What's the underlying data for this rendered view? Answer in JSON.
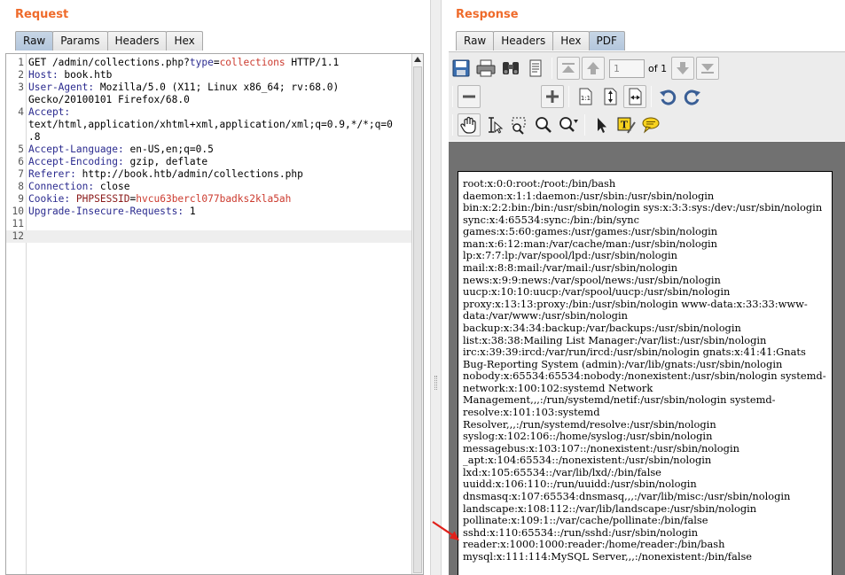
{
  "request": {
    "title": "Request",
    "tabs": [
      "Raw",
      "Params",
      "Headers",
      "Hex"
    ],
    "active_tab": "Raw",
    "lines": [
      {
        "num": "1",
        "segments": [
          {
            "t": "GET /admin/collections.php?",
            "c": "hval"
          },
          {
            "t": "type",
            "c": "pname"
          },
          {
            "t": "=",
            "c": "hval"
          },
          {
            "t": "collections",
            "c": "pval"
          },
          {
            "t": " HTTP/1.1",
            "c": "hval"
          }
        ]
      },
      {
        "num": "2",
        "segments": [
          {
            "t": "Host:",
            "c": "hname"
          },
          {
            "t": " book.htb",
            "c": "hval"
          }
        ]
      },
      {
        "num": "3",
        "segments": [
          {
            "t": "User-Agent:",
            "c": "hname"
          },
          {
            "t": " Mozilla/5.0 (X11; Linux x86_64; rv:68.0)",
            "c": "hval"
          }
        ]
      },
      {
        "num": "",
        "segments": [
          {
            "t": "Gecko/20100101 Firefox/68.0",
            "c": "hval"
          }
        ]
      },
      {
        "num": "4",
        "segments": [
          {
            "t": "Accept:",
            "c": "hname"
          }
        ]
      },
      {
        "num": "",
        "segments": [
          {
            "t": "text/html,application/xhtml+xml,application/xml;q=0.9,*/*;q=0",
            "c": "hval"
          }
        ]
      },
      {
        "num": "",
        "segments": [
          {
            "t": ".8",
            "c": "hval"
          }
        ]
      },
      {
        "num": "5",
        "segments": [
          {
            "t": "Accept-Language:",
            "c": "hname"
          },
          {
            "t": " en-US,en;q=0.5",
            "c": "hval"
          }
        ]
      },
      {
        "num": "6",
        "segments": [
          {
            "t": "Accept-Encoding:",
            "c": "hname"
          },
          {
            "t": " gzip, deflate",
            "c": "hval"
          }
        ]
      },
      {
        "num": "7",
        "segments": [
          {
            "t": "Referer:",
            "c": "hname"
          },
          {
            "t": " http://book.htb/admin/collections.php",
            "c": "hval"
          }
        ]
      },
      {
        "num": "8",
        "segments": [
          {
            "t": "Connection:",
            "c": "hname"
          },
          {
            "t": " close",
            "c": "hval"
          }
        ]
      },
      {
        "num": "9",
        "segments": [
          {
            "t": "Cookie:",
            "c": "hname"
          },
          {
            "t": " ",
            "c": "hval"
          },
          {
            "t": "PHPSESSID",
            "c": "cname"
          },
          {
            "t": "=",
            "c": "hval"
          },
          {
            "t": "hvcu63bercl077badks2kla5ah",
            "c": "cval"
          }
        ]
      },
      {
        "num": "10",
        "segments": [
          {
            "t": "Upgrade-Insecure-Requests:",
            "c": "hname"
          },
          {
            "t": " 1",
            "c": "hval"
          }
        ]
      },
      {
        "num": "11",
        "segments": []
      },
      {
        "num": "12",
        "segments": [],
        "current": true
      }
    ]
  },
  "response": {
    "title": "Response",
    "tabs": [
      "Raw",
      "Headers",
      "Hex",
      "PDF"
    ],
    "active_tab": "PDF",
    "toolbar": {
      "page_value": "1",
      "page_of": "of 1",
      "row1_icons": [
        "save-icon",
        "print-icon",
        "binoculars-icon",
        "document-properties-icon",
        "first-page-icon",
        "previous-page-icon",
        "next-page-icon",
        "last-page-icon"
      ],
      "row2_icons": [
        "zoom-out-icon",
        "zoom-in-icon",
        "actual-size-icon",
        "fit-page-icon",
        "fit-width-icon",
        "rotate-left-icon",
        "rotate-right-icon"
      ],
      "row3_icons": [
        "hand-tool-icon",
        "text-select-icon",
        "area-select-icon",
        "magnifier-icon",
        "zoom-dropdown-icon",
        "pointer-icon",
        "annotate-icon",
        "comment-icon"
      ]
    },
    "pdf_lines": [
      "root:x:0:0:root:/root:/bin/bash",
      "daemon:x:1:1:daemon:/usr/sbin:/usr/sbin/nologin",
      "bin:x:2:2:bin:/bin:/usr/sbin/nologin sys:x:3:3:sys:/dev:/usr/sbin/nologin",
      "sync:x:4:65534:sync:/bin:/bin/sync",
      "games:x:5:60:games:/usr/games:/usr/sbin/nologin",
      "man:x:6:12:man:/var/cache/man:/usr/sbin/nologin",
      "lp:x:7:7:lp:/var/spool/lpd:/usr/sbin/nologin",
      "mail:x:8:8:mail:/var/mail:/usr/sbin/nologin",
      "news:x:9:9:news:/var/spool/news:/usr/sbin/nologin",
      "uucp:x:10:10:uucp:/var/spool/uucp:/usr/sbin/nologin",
      "proxy:x:13:13:proxy:/bin:/usr/sbin/nologin www-data:x:33:33:www-",
      "data:/var/www:/usr/sbin/nologin",
      "backup:x:34:34:backup:/var/backups:/usr/sbin/nologin",
      "list:x:38:38:Mailing List Manager:/var/list:/usr/sbin/nologin",
      "irc:x:39:39:ircd:/var/run/ircd:/usr/sbin/nologin gnats:x:41:41:Gnats",
      "Bug-Reporting System (admin):/var/lib/gnats:/usr/sbin/nologin",
      "nobody:x:65534:65534:nobody:/nonexistent:/usr/sbin/nologin systemd-",
      "network:x:100:102:systemd Network",
      "Management,,,:/run/systemd/netif:/usr/sbin/nologin systemd-",
      "resolve:x:101:103:systemd",
      "Resolver,,,:/run/systemd/resolve:/usr/sbin/nologin",
      "syslog:x:102:106::/home/syslog:/usr/sbin/nologin",
      "messagebus:x:103:107::/nonexistent:/usr/sbin/nologin",
      "_apt:x:104:65534::/nonexistent:/usr/sbin/nologin",
      "lxd:x:105:65534::/var/lib/lxd/:/bin/false",
      "uuidd:x:106:110::/run/uuidd:/usr/sbin/nologin",
      "dnsmasq:x:107:65534:dnsmasq,,,:/var/lib/misc:/usr/sbin/nologin",
      "landscape:x:108:112::/var/lib/landscape:/usr/sbin/nologin",
      "pollinate:x:109:1::/var/cache/pollinate:/bin/false",
      "sshd:x:110:65534::/run/sshd:/usr/sbin/nologin",
      "reader:x:1000:1000:reader:/home/reader:/bin/bash",
      "mysql:x:111:114:MySQL Server,,,:/nonexistent:/bin/false"
    ],
    "annotation": {
      "icon": "red-arrow-icon",
      "color": "#e0211b"
    }
  },
  "colors": {
    "accent": "#ef6b2b",
    "active_tab": "#b3c6dc"
  }
}
